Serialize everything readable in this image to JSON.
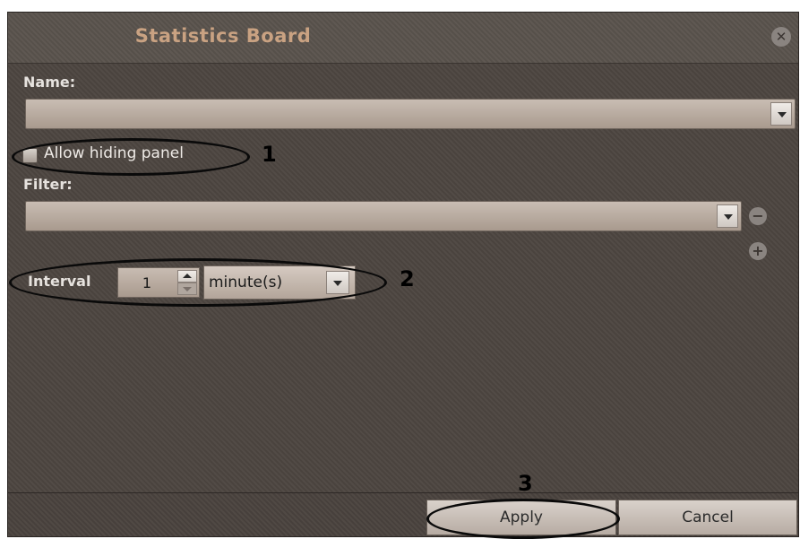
{
  "dialog": {
    "title": "Statistics Board",
    "close_symbol": "✕"
  },
  "name": {
    "label": "Name:",
    "value": ""
  },
  "allow_hiding": {
    "label": "Allow hiding panel",
    "checked": false
  },
  "filter": {
    "label": "Filter:",
    "value": "",
    "remove_symbol": "−",
    "add_symbol": "+"
  },
  "interval": {
    "label": "Interval",
    "value": "1",
    "unit": "minute(s)"
  },
  "buttons": {
    "apply": "Apply",
    "cancel": "Cancel"
  },
  "annotations": {
    "n1": "1",
    "n2": "2",
    "n3": "3"
  },
  "colors": {
    "title": "#c9a282",
    "background": "#4c4540",
    "annotation": "#000000"
  }
}
